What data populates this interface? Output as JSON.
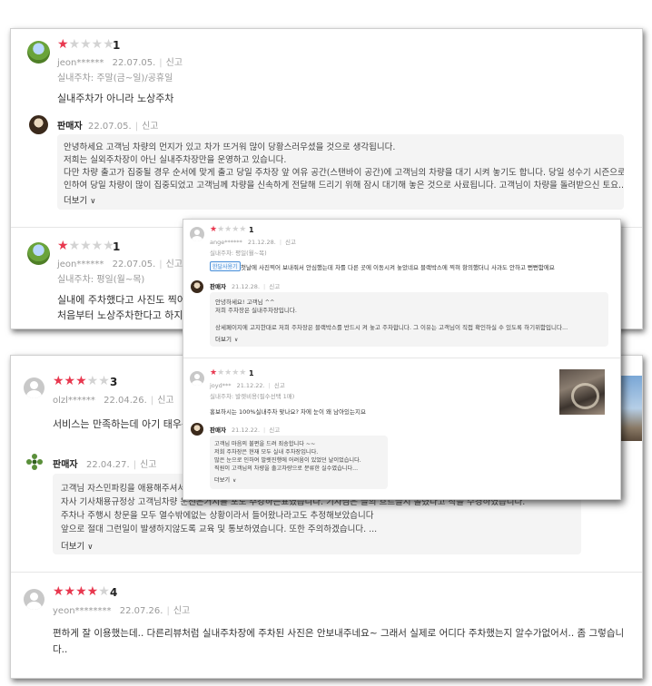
{
  "review_top": {
    "rating": "1",
    "stars_filled": 1,
    "user": "jeon******",
    "date": "22.07.05.",
    "report": "신고",
    "category": "실내주차: 주말(금~일)/공휴일",
    "body": "실내주차가 아니라 노상주차",
    "seller": {
      "name": "판매자",
      "date": "22.07.05.",
      "report": "신고"
    },
    "reply_lines": [
      "안녕하세요 고객님 차량의 먼지가 있고 차가 뜨거워 많이 당황스러우셨을 것으로 생각됩니다.",
      "저희는 실외주차장이 아닌 실내주차장만을 운영하고 있습니다.",
      "다만 차량 출고가 집중될 경우 순서에 맞게 출고 당일 주차장 앞 여유 공간(스탠바이 공간)에 고객님의 차량을 대기 시켜 놓기도 합니다. 당일 성수기 시즌으로",
      "인하여 당일 차량이 많이 집중되었고 고객님께 차량을 신속하게 전달해 드리기 위해 잠시 대기해 놓은 것으로 사료됩니다. 고객님이 차량을 돌려받으신 토요..."
    ],
    "more": "더보기"
  },
  "review_second": {
    "rating": "1",
    "stars_filled": 1,
    "user": "jeon******",
    "date": "22.07.05.",
    "report": "신고",
    "category": "실내주차: 평일(월~목)",
    "body_lines": [
      "실내에 주차했다고 사진도 찍어 보",
      "처음부터 노상주차한다고 하지..정"
    ]
  },
  "review_olzl": {
    "rating": "3",
    "stars_filled": 3,
    "user": "olzl******",
    "date": "22.04.26.",
    "report": "신고",
    "body": "서비스는 만족하는데 아기 태우는",
    "seller": {
      "name": "판매자",
      "date": "22.04.27.",
      "report": "신고"
    },
    "reply_lines": [
      "고객님 자스민파킹을 애용해주셔서",
      "자사 기사채용규정상 고객님차량 운전은거지를 포도 주강하는표였습니다. 기자님은 늘의 흐르늘지 돌렸다고 작을 수경하였습니다.",
      "주차나 주행시 창문을 모두 열수밖에없는 상황이라서 들어왔나라고도 추정해보았습니다",
      "앞으로 절대 그런일이 발생하지않도록 교육 및 통보하였습니다. 또한 주의하겠습니다. ..."
    ],
    "more": "더보기"
  },
  "review_yeon": {
    "rating": "4",
    "stars_filled": 4,
    "user": "yeon********",
    "date": "22.07.26.",
    "report": "신고",
    "body_lines": [
      "편하게 잘 이용했는데.. 다른리뷰처럼 실내주차장에 주차된 사진은 안보내주네요~ 그래서 실제로 어디다 주차했는지 알수가없어서.. 좀 그렇습니",
      "다.."
    ]
  },
  "overlay": {
    "review_a": {
      "rating": "1",
      "stars_filled": 1,
      "user": "ange******",
      "date": "21.12.28.",
      "report": "신고",
      "category": "실내주차: 평일(월~목)",
      "badge": "한달사용기",
      "body": "첫날에 사진찍어 보내줘서 안심했는데  차를 다른 곳에 이동시켜 놓았네요 블랙박스에 찍혀 항의했더니 사과도 안하고 뻔뻔함에요",
      "seller": {
        "name": "판매자",
        "date": "21.12.28.",
        "report": "신고"
      },
      "reply_lines": [
        "안녕하세요! 고객님 ^^",
        "저희 주차장은 실내주차장입니다.",
        "",
        "상세페이지에 고지한대로 저희 주차장은 블랙박스를 반드시 켜 놓고 주차합니다. 그 이유는 고객님이 직접 확인하실 수 있도록 하기위함입니다..."
      ],
      "more": "더보기"
    },
    "review_b": {
      "rating": "1",
      "stars_filled": 1,
      "user": "joyd***",
      "date": "21.12.22.",
      "report": "신고",
      "category": "실내주차: 발렛비용(필수선택 1매)",
      "body": "홍보하시는 100%실내주차 맞나요? 차에 눈이 왜 남아있는지요",
      "seller": {
        "name": "판매자",
        "date": "21.12.22.",
        "report": "신고"
      },
      "reply_lines": [
        "고객님 마음의 불편을 드려 죄송합니다 ~~",
        "저희 주차장은 현재 모두 실내 주차장입니다.",
        "많은 눈으로 인하여 발렛진행에 어려움이 있었던 날이었습니다.",
        "직원이 고객님의 차량을 출고차량으로 분류한 실수였습니다..."
      ],
      "more": "더보기"
    }
  },
  "colors": {
    "star_on": "#e8384f",
    "star_off": "#d3d3d3",
    "text_gray": "#999999",
    "reply_bg": "#f4f4f4"
  }
}
